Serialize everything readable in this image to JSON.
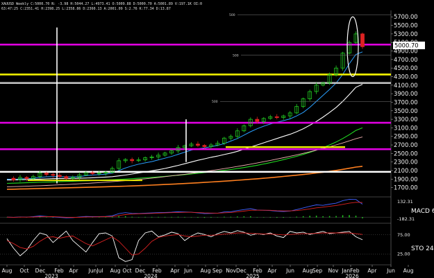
{
  "header": {
    "line1": "XAUUSD Weekly C:5000.70 N: -3.98 H:5044.27 L:4973.41 O:5009.88 D:5000.70 A:5001.89 V:197.1K OI:0",
    "line2": "63:47:25  C:2351.41  H:2398.25  L:2358.86  D:2360.13  A:2001.09  S:2.76 K:77.34 D:13.87"
  },
  "price_label": "5000.70",
  "macd_label": "MACD 6",
  "sto_label": "STO 24",
  "colors": {
    "background": "#000000",
    "up_candle": "#22cc22",
    "down_candle": "#dd2222",
    "magenta": "#e000e0",
    "yellow_line": "#f0f000",
    "white_line": "#ffffff",
    "green_ma": "#22dd22",
    "orange_ma": "#ff8020",
    "pink_ma": "#f0b0b0",
    "signal": "#dd2222"
  },
  "chart_data": [
    {
      "type": "line",
      "title": "XAUUSD Weekly",
      "ylim": [
        1500,
        5850
      ],
      "y_ticks": [
        "5700.00",
        "5500.00",
        "5300.00",
        "5100.00",
        "4900.00",
        "4700.00",
        "4500.00",
        "4300.00",
        "4100.00",
        "3900.00",
        "3700.00",
        "3500.00",
        "3300.00",
        "3100.00",
        "2900.00",
        "2700.00",
        "2500.00",
        "2300.00",
        "2100.00",
        "1900.00",
        "1700.00"
      ],
      "x_ticks": [
        "Aug",
        "Oct",
        "Dec",
        "Feb",
        "Apr",
        "JunJul",
        "Aug",
        "Oct",
        "Dec",
        "Feb",
        "Apr",
        "Jun",
        "Aug",
        "Sep",
        "NovDec",
        "Feb",
        "Apr",
        "Jun",
        "Aug",
        "Sep",
        "Nov",
        "JanFeb",
        "Apr",
        "Jun",
        "Aug"
      ],
      "x_years": [
        "2023",
        "2024",
        "2025",
        "2026"
      ],
      "last_price": 5000.7,
      "horizontal_levels": [
        {
          "name": "resistance-magenta-top",
          "value": 5050,
          "color": "#e000e0"
        },
        {
          "name": "support-yellow-upper",
          "value": 4350,
          "color": "#f0f000"
        },
        {
          "name": "support-gray-upper",
          "value": 4150,
          "color": "#c0c0c0"
        },
        {
          "name": "resistance-magenta-mid",
          "value": 3220,
          "color": "#e000e0"
        },
        {
          "name": "support-magenta-low",
          "value": 2600,
          "color": "#e000e0"
        },
        {
          "name": "support-white-low",
          "value": 2070,
          "color": "#ffffff"
        }
      ],
      "fib_labels": [
        "500",
        "500",
        "500"
      ],
      "series": [
        {
          "values": [
            1920,
            1880,
            1940,
            1910,
            1960,
            2040,
            2010,
            1990,
            1960,
            1920,
            1940,
            2000,
            2050,
            2030,
            2040,
            2060,
            2150,
            2330,
            2360,
            2330,
            2350,
            2400,
            2420,
            2460,
            2510,
            2560,
            2640,
            2680,
            2720,
            2690,
            2660,
            2700,
            2740,
            2860,
            2900,
            3030,
            3150,
            3300,
            3250,
            3320,
            3360,
            3340,
            3380,
            3450,
            3600,
            3780,
            3950,
            4100,
            4150,
            4350,
            4500,
            4850,
            5100,
            5300,
            5000
          ]
        },
        {
          "values": [
            1900,
            1895,
            1905,
            1910,
            1920,
            1940,
            1955,
            1960,
            1960,
            1955,
            1950,
            1960,
            1980,
            1995,
            2005,
            2015,
            2040,
            2100,
            2160,
            2210,
            2250,
            2280,
            2310,
            2350,
            2390,
            2430,
            2480,
            2530,
            2580,
            2610,
            2630,
            2660,
            2690,
            2730,
            2790,
            2850,
            2930,
            3010,
            3080,
            3140,
            3190,
            3230,
            3270,
            3310,
            3380,
            3460,
            3580,
            3720,
            3860,
            4000,
            4150,
            4350,
            4600,
            4820,
            4880
          ]
        },
        {
          "values": [
            1880,
            1880,
            1885,
            1890,
            1895,
            1900,
            1905,
            1910,
            1915,
            1915,
            1915,
            1920,
            1925,
            1932,
            1940,
            1948,
            1958,
            1975,
            1995,
            2020,
            2045,
            2070,
            2095,
            2120,
            2150,
            2185,
            2220,
            2260,
            2300,
            2340,
            2375,
            2410,
            2440,
            2475,
            2510,
            2550,
            2600,
            2650,
            2700,
            2750,
            2800,
            2850,
            2900,
            2950,
            3010,
            3080,
            3160,
            3250,
            3350,
            3460,
            3580,
            3720,
            3880,
            4050,
            4120
          ]
        },
        {
          "values": [
            1800,
            1805,
            1810,
            1815,
            1820,
            1825,
            1830,
            1835,
            1840,
            1845,
            1850,
            1855,
            1860,
            1866,
            1872,
            1878,
            1885,
            1893,
            1901,
            1910,
            1920,
            1930,
            1940,
            1952,
            1964,
            1977,
            1990,
            2005,
            2020,
            2036,
            2053,
            2070,
            2088,
            2106,
            2125,
            2146,
            2170,
            2196,
            2224,
            2254,
            2286,
            2320,
            2356,
            2394,
            2434,
            2478,
            2526,
            2578,
            2636,
            2700,
            2770,
            2850,
            2940,
            3040,
            3100
          ]
        },
        {
          "values": [
            1660,
            1664,
            1668,
            1672,
            1676,
            1680,
            1684,
            1688,
            1692,
            1696,
            1700,
            1704,
            1708,
            1712,
            1716,
            1720,
            1725,
            1730,
            1735,
            1741,
            1747,
            1753,
            1760,
            1767,
            1774,
            1781,
            1789,
            1797,
            1805,
            1814,
            1823,
            1832,
            1842,
            1852,
            1862,
            1873,
            1884,
            1896,
            1908,
            1921,
            1934,
            1948,
            1962,
            1977,
            1992,
            2008,
            2025,
            2043,
            2062,
            2082,
            2104,
            2128,
            2154,
            2182,
            2200
          ]
        }
      ]
    },
    {
      "type": "line",
      "title": "MACD 6",
      "y_ticks": [
        "132.31",
        "-182.31"
      ],
      "series": [
        {
          "values": [
            0,
            -2,
            2,
            0,
            4,
            10,
            6,
            2,
            -2,
            -6,
            -4,
            2,
            6,
            4,
            4,
            6,
            12,
            30,
            38,
            32,
            30,
            34,
            36,
            38,
            40,
            42,
            46,
            44,
            42,
            36,
            30,
            32,
            34,
            44,
            46,
            56,
            64,
            72,
            60,
            58,
            56,
            50,
            48,
            52,
            64,
            78,
            92,
            104,
            100,
            110,
            118,
            140,
            152,
            150,
            110
          ]
        },
        {
          "values": [
            0,
            -1,
            0,
            0,
            1,
            4,
            5,
            4,
            2,
            -1,
            -2,
            -1,
            1,
            2,
            3,
            4,
            6,
            14,
            22,
            26,
            28,
            30,
            32,
            34,
            36,
            38,
            40,
            41,
            41,
            39,
            36,
            35,
            34,
            37,
            40,
            45,
            51,
            58,
            59,
            59,
            58,
            55,
            53,
            53,
            56,
            62,
            70,
            79,
            85,
            92,
            99,
            108,
            118,
            126,
            124
          ]
        }
      ]
    },
    {
      "type": "line",
      "title": "STO 24",
      "y_ticks": [
        "75.00",
        "25.00"
      ],
      "series": [
        {
          "values": [
            65,
            40,
            20,
            35,
            60,
            80,
            75,
            55,
            70,
            85,
            60,
            45,
            30,
            55,
            78,
            80,
            72,
            15,
            5,
            10,
            60,
            80,
            85,
            70,
            75,
            82,
            78,
            60,
            72,
            80,
            76,
            70,
            78,
            84,
            80,
            86,
            82,
            74,
            78,
            76,
            80,
            72,
            68,
            84,
            80,
            82,
            76,
            80,
            84,
            78,
            80,
            82,
            84,
            70,
            62
          ]
        },
        {
          "values": [
            60,
            52,
            42,
            38,
            45,
            58,
            68,
            70,
            66,
            70,
            72,
            62,
            52,
            46,
            54,
            62,
            70,
            58,
            40,
            22,
            25,
            40,
            58,
            68,
            72,
            74,
            76,
            72,
            70,
            72,
            74,
            74,
            75,
            77,
            78,
            80,
            80,
            79,
            78,
            77,
            77,
            76,
            75,
            76,
            77,
            78,
            78,
            79,
            80,
            80,
            80,
            80,
            80,
            78,
            76
          ]
        }
      ]
    }
  ]
}
